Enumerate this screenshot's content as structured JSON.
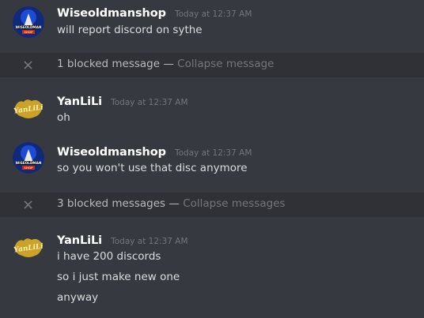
{
  "messages": [
    {
      "author": "Wiseoldmanshop",
      "timestamp": "Today at 12:37 AM",
      "avatar_text_top": "WISEOLDMAN",
      "avatar_text_bottom": "SHOP",
      "lines": [
        "will report discord on sythe"
      ]
    },
    {
      "author": "YanLiLi",
      "timestamp": "Today at 12:37 AM",
      "avatar_text": "YanLiLi",
      "lines": [
        "oh"
      ]
    },
    {
      "author": "Wiseoldmanshop",
      "timestamp": "Today at 12:37 AM",
      "avatar_text_top": "WISEOLDMAN",
      "avatar_text_bottom": "SHOP",
      "lines": [
        "so you won't use that disc anymore"
      ]
    },
    {
      "author": "YanLiLi",
      "timestamp": "Today at 12:37 AM",
      "avatar_text": "YanLiLi",
      "lines": [
        "i have 200 discords",
        "so i just make new one",
        "anyway"
      ]
    }
  ],
  "blocked": [
    {
      "label": "1 blocked message",
      "separator": " — ",
      "collapse": "Collapse message"
    },
    {
      "label": "3 blocked messages",
      "separator": " — ",
      "collapse": "Collapse messages"
    }
  ],
  "colors": {
    "background": "#36393f",
    "blocked_bar": "#2f3136",
    "author": "#ffffff",
    "timestamp": "#72767d",
    "text": "#dcddde"
  },
  "icons": {
    "close": "close-icon"
  }
}
